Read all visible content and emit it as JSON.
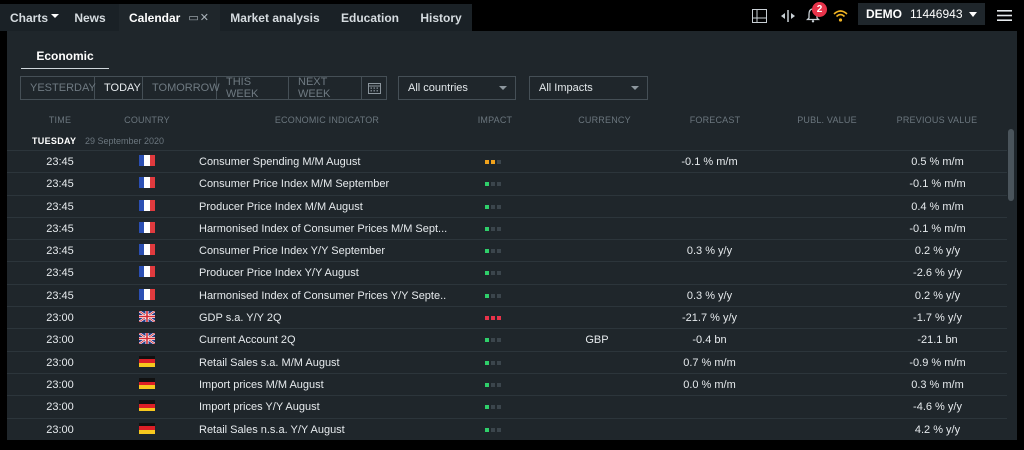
{
  "tabs": [
    {
      "label": "Charts"
    },
    {
      "label": "News"
    },
    {
      "label": "Calendar"
    },
    {
      "label": "Market analysis"
    },
    {
      "label": "Education"
    },
    {
      "label": "History"
    }
  ],
  "notifications_count": "2",
  "account": {
    "mode": "DEMO",
    "number": "11446943"
  },
  "subtab": "Economic",
  "filters": {
    "periods": [
      "YESTERDAY",
      "TODAY",
      "TOMORROW",
      "THIS WEEK",
      "NEXT WEEK"
    ],
    "active_period": "TODAY",
    "country": "All countries",
    "impact": "All Impacts"
  },
  "columns": [
    "TIME",
    "COUNTRY",
    "ECONOMIC INDICATOR",
    "IMPACT",
    "CURRENCY",
    "FORECAST",
    "PUBL. VALUE",
    "PREVIOUS VALUE"
  ],
  "day": {
    "label": "TUESDAY",
    "date": "29 September 2020"
  },
  "colors": {
    "impact_low": "#2fcf6a",
    "impact_medium": "#f0a21c",
    "impact_high": "#e8334a",
    "impact_off": "#3b454c"
  },
  "events": [
    {
      "time": "23:45",
      "country": "fr",
      "indicator": "Consumer Spending M/M August",
      "impact": "medium",
      "currency": "",
      "forecast": "-0.1 % m/m",
      "publ_value": "",
      "previous": "0.5 % m/m"
    },
    {
      "time": "23:45",
      "country": "fr",
      "indicator": "Consumer Price Index M/M September",
      "impact": "low",
      "currency": "",
      "forecast": "",
      "publ_value": "",
      "previous": "-0.1 % m/m"
    },
    {
      "time": "23:45",
      "country": "fr",
      "indicator": "Producer Price Index M/M August",
      "impact": "low",
      "currency": "",
      "forecast": "",
      "publ_value": "",
      "previous": "0.4 % m/m"
    },
    {
      "time": "23:45",
      "country": "fr",
      "indicator": "Harmonised Index of Consumer Prices M/M Sept...",
      "impact": "low",
      "currency": "",
      "forecast": "",
      "publ_value": "",
      "previous": "-0.1 % m/m"
    },
    {
      "time": "23:45",
      "country": "fr",
      "indicator": "Consumer Price Index Y/Y September",
      "impact": "low",
      "currency": "",
      "forecast": "0.3 % y/y",
      "publ_value": "",
      "previous": "0.2 % y/y"
    },
    {
      "time": "23:45",
      "country": "fr",
      "indicator": "Producer Price Index Y/Y August",
      "impact": "low",
      "currency": "",
      "forecast": "",
      "publ_value": "",
      "previous": "-2.6 % y/y"
    },
    {
      "time": "23:45",
      "country": "fr",
      "indicator": "Harmonised Index of Consumer Prices Y/Y Septe..",
      "impact": "low",
      "currency": "",
      "forecast": "0.3 % y/y",
      "publ_value": "",
      "previous": "0.2 % y/y"
    },
    {
      "time": "23:00",
      "country": "gb",
      "indicator": "GDP s.a. Y/Y 2Q",
      "impact": "high",
      "currency": "",
      "forecast": "-21.7 % y/y",
      "publ_value": "",
      "previous": "-1.7 % y/y"
    },
    {
      "time": "23:00",
      "country": "gb",
      "indicator": "Current Account 2Q",
      "impact": "low",
      "currency": "GBP",
      "forecast": "-0.4 bn",
      "publ_value": "",
      "previous": "-21.1 bn"
    },
    {
      "time": "23:00",
      "country": "de",
      "indicator": "Retail Sales s.a. M/M August",
      "impact": "low",
      "currency": "",
      "forecast": "0.7 % m/m",
      "publ_value": "",
      "previous": "-0.9 % m/m"
    },
    {
      "time": "23:00",
      "country": "de",
      "indicator": "Import prices M/M August",
      "impact": "low",
      "currency": "",
      "forecast": "0.0 % m/m",
      "publ_value": "",
      "previous": "0.3 % m/m"
    },
    {
      "time": "23:00",
      "country": "de",
      "indicator": "Import prices Y/Y August",
      "impact": "low",
      "currency": "",
      "forecast": "",
      "publ_value": "",
      "previous": "-4.6 % y/y"
    },
    {
      "time": "23:00",
      "country": "de",
      "indicator": "Retail Sales n.s.a. Y/Y August",
      "impact": "low",
      "currency": "",
      "forecast": "",
      "publ_value": "",
      "previous": "4.2 % y/y"
    }
  ]
}
